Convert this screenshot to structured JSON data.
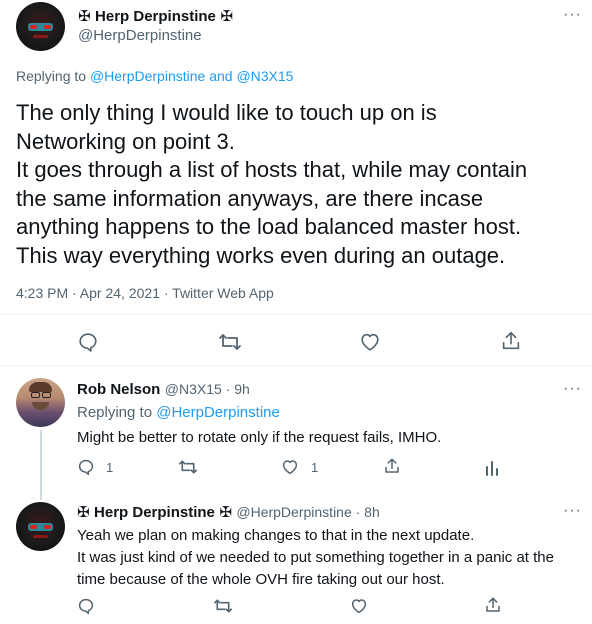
{
  "main_tweet": {
    "author_name": "Herp Derpinstine",
    "badge_glyph": "✠",
    "handle": "@HerpDerpinstine",
    "replying_prefix": "Replying to",
    "replying_user1": "@HerpDerpinstine",
    "replying_and": "and",
    "replying_user2": "@N3X15",
    "lines": [
      "The only thing I would like to touch up on is",
      "Networking on point 3.",
      "It goes through a list of hosts that, while may contain",
      "the same information anyways, are there incase",
      "anything happens to the load balanced master host.",
      "This way everything works even during an outage."
    ],
    "timestamp": "4:23 PM · Apr 24, 2021 · Twitter Web App",
    "more": "···"
  },
  "reply1": {
    "author_name": "Rob Nelson",
    "handle_time": "@N3X15 · 9h",
    "replying_prefix": "Replying to",
    "replying_user": "@HerpDerpinstine",
    "text": "Might be better to rotate only if the request fails, IMHO.",
    "reply_count": "1",
    "like_count": "1",
    "more": "···"
  },
  "reply2": {
    "author_name": "Herp Derpinstine",
    "badge_glyph": "✠",
    "handle_time": "@HerpDerpinstine · 8h",
    "lines": [
      "Yeah we plan on making changes to that in the next update.",
      "It was just kind of we needed to put something together in a panic at the",
      "time because of the whole OVH fire taking out our host."
    ],
    "more": "···"
  },
  "icons": {
    "reply": "reply-icon",
    "retweet": "retweet-icon",
    "like": "heart-icon",
    "share": "share-icon",
    "analytics": "analytics-icon",
    "more": "more-icon"
  },
  "colors": {
    "link": "#1d9bf0",
    "secondary_text": "#536471",
    "primary_text": "#0f1419",
    "divider": "#eff3f4"
  }
}
